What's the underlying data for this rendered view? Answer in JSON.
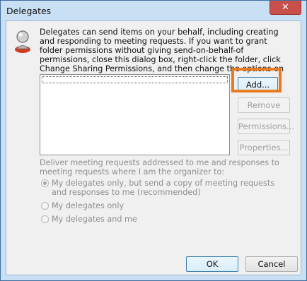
{
  "window": {
    "title": "Delegates",
    "close_glyph": "✕"
  },
  "description": "Delegates can send items on your behalf, including creating and responding to meeting requests. If you want to grant folder permissions without giving send-on-behalf-of permissions, close this dialog box, right-click the folder, click Change Sharing Permissions, and then change the options on the Permissions tab.",
  "icons": {
    "person": "person-icon",
    "close": "close-icon"
  },
  "buttons": {
    "add": "Add...",
    "remove": "Remove",
    "permissions": "Permissions...",
    "properties": "Properties...",
    "ok": "OK",
    "cancel": "Cancel"
  },
  "delegates": [],
  "meeting_requests": {
    "label": "Deliver meeting requests addressed to me and responses to meeting requests where I am the organizer to:",
    "options": [
      {
        "label": "My delegates only, but send a copy of meeting requests and responses to me (recommended)",
        "checked": true
      },
      {
        "label": "My delegates only",
        "checked": false
      },
      {
        "label": "My delegates and me",
        "checked": false
      }
    ]
  },
  "colors": {
    "highlight": "#ea7a20",
    "title_bar": "#c9dff3",
    "close": "#c7504b"
  }
}
